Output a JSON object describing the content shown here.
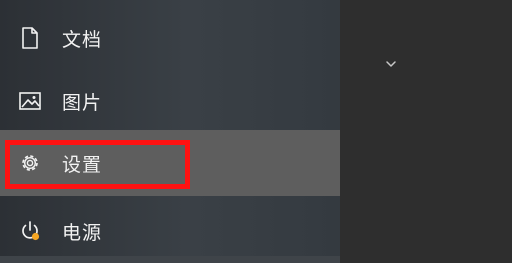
{
  "menu": {
    "items": [
      {
        "label": "文档",
        "icon": "document-icon"
      },
      {
        "label": "图片",
        "icon": "image-icon"
      },
      {
        "label": "设置",
        "icon": "gear-icon",
        "selected": true
      },
      {
        "label": "电源",
        "icon": "power-icon"
      }
    ]
  },
  "expand": {
    "icon": "chevron-down-icon"
  },
  "colors": {
    "highlight_border": "#ff1212",
    "selected_background": "#5e5e5e",
    "power_badge": "#f5a623"
  }
}
